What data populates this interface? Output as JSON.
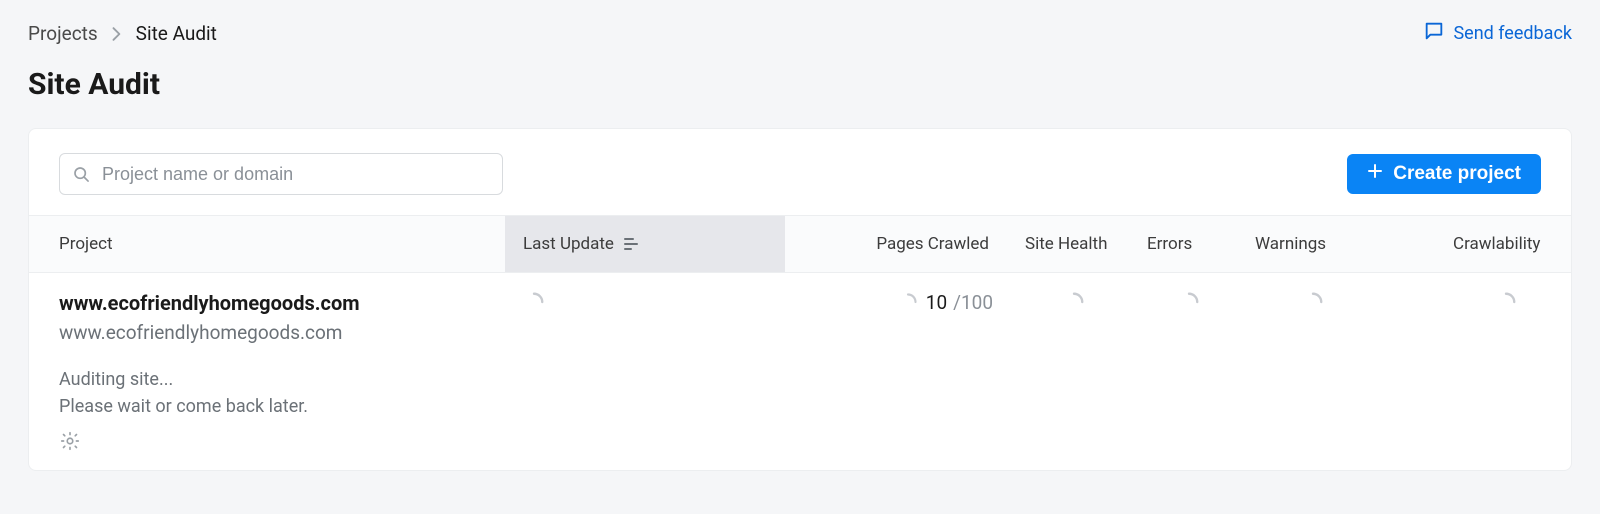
{
  "breadcrumb": {
    "root": "Projects",
    "current": "Site Audit"
  },
  "page": {
    "title": "Site Audit"
  },
  "feedback": {
    "label": "Send feedback"
  },
  "search": {
    "placeholder": "Project name or domain"
  },
  "create_button": {
    "label": "Create project"
  },
  "columns": {
    "project": "Project",
    "last_update": "Last Update",
    "pages_crawled": "Pages Crawled",
    "site_health": "Site Health",
    "errors": "Errors",
    "warnings": "Warnings",
    "crawlability": "Crawlability"
  },
  "rows": [
    {
      "name": "www.ecofriendlyhomegoods.com",
      "domain": "www.ecofriendlyhomegoods.com",
      "status_line1": "Auditing site...",
      "status_line2": "Please wait or come back later.",
      "pages_done": "10",
      "pages_total": "/100"
    }
  ]
}
